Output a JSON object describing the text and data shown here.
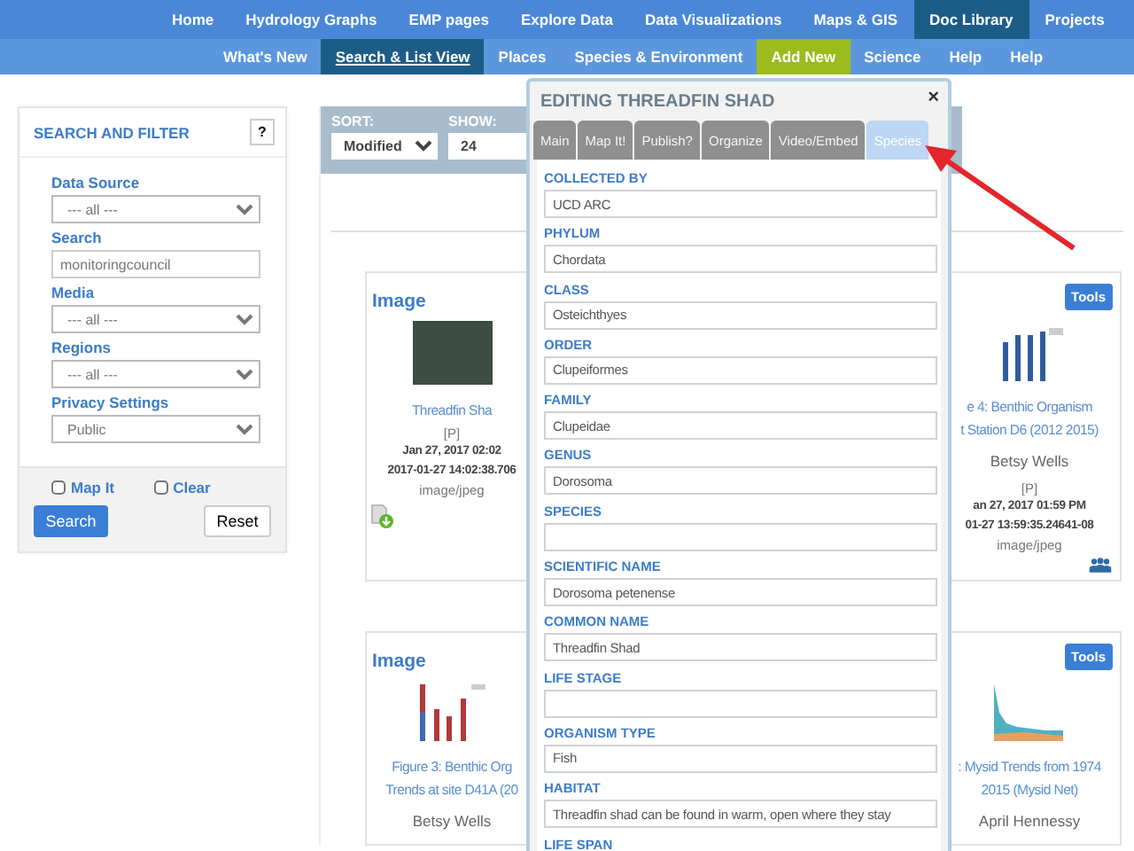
{
  "top_nav": [
    {
      "label": "Home",
      "selected": false
    },
    {
      "label": "Hydrology Graphs",
      "selected": false
    },
    {
      "label": "EMP pages",
      "selected": false
    },
    {
      "label": "Explore Data",
      "selected": false
    },
    {
      "label": "Data Visualizations",
      "selected": false
    },
    {
      "label": "Maps & GIS",
      "selected": false
    },
    {
      "label": "Doc Library",
      "selected": true
    },
    {
      "label": "Projects",
      "selected": false
    }
  ],
  "sub_nav": [
    {
      "label": "What's New",
      "selected": false,
      "kind": "link"
    },
    {
      "label": "Search & List View",
      "selected": true,
      "kind": "link"
    },
    {
      "label": "Places",
      "selected": false,
      "kind": "link"
    },
    {
      "label": "Species & Environment",
      "selected": false,
      "kind": "link"
    },
    {
      "label": "Add New",
      "selected": false,
      "kind": "accent"
    },
    {
      "label": "Science",
      "selected": false,
      "kind": "link"
    },
    {
      "label": "Help",
      "selected": false,
      "kind": "link"
    },
    {
      "label": "Help",
      "selected": false,
      "kind": "link"
    }
  ],
  "filter_panel": {
    "title": "SEARCH AND FILTER",
    "help_button": "?",
    "fields": [
      {
        "label": "Data Source",
        "kind": "select",
        "value": "--- all ---"
      },
      {
        "label": "Search",
        "kind": "text",
        "value": "monitoringcouncil"
      },
      {
        "label": "Media",
        "kind": "select",
        "value": "--- all ---"
      },
      {
        "label": "Regions",
        "kind": "select",
        "value": "--- all ---"
      },
      {
        "label": "Privacy Settings",
        "kind": "select",
        "value": "Public"
      }
    ],
    "checkboxes": [
      {
        "label": "Map It",
        "checked": false
      },
      {
        "label": "Clear",
        "checked": false
      }
    ],
    "search_button": "Search",
    "reset_button": "Reset"
  },
  "toolbar": {
    "sort": {
      "label": "SORT:",
      "value": "Modified"
    },
    "show": {
      "label": "SHOW:",
      "value": "24"
    }
  },
  "cards": [
    {
      "title": "Image",
      "tools_button": "Tools",
      "items": [
        {
          "kind": "photo",
          "title_lines": [
            "Threadfin Sha"
          ],
          "badge": "[P]",
          "date": "Jan 27, 2017 02:02",
          "timestamp": "2017-01-27 14:02:38.706",
          "mime": "image/jpeg"
        },
        {
          "kind": "bar_chart",
          "title_lines": [
            "e 4: Benthic Organism",
            "t Station D6 (2012 2015)"
          ],
          "author": "Betsy Wells",
          "badge": "[P]",
          "date": "an 27, 2017 01:59 PM",
          "timestamp": "01-27 13:59:35.24641-08",
          "mime": "image/jpeg"
        }
      ]
    },
    {
      "title": "Image",
      "tools_button": "Tools",
      "items": [
        {
          "kind": "stacked_bar",
          "title_lines": [
            "Figure 3: Benthic Org",
            "Trends at site D41A (20"
          ],
          "author": "Betsy Wells"
        },
        {
          "kind": "histogram",
          "title_lines": [
            ": Mysid Trends from 1974",
            "2015 (Mysid Net)"
          ],
          "author": "April Hennessy"
        }
      ]
    }
  ],
  "editor": {
    "title": "EDITING THREADFIN SHAD",
    "close": "×",
    "tabs": [
      {
        "label": "Main",
        "selected": false
      },
      {
        "label": "Map It!",
        "selected": false
      },
      {
        "label": "Publish?",
        "selected": false
      },
      {
        "label": "Organize",
        "selected": false
      },
      {
        "label": "Video/Embed",
        "selected": false
      },
      {
        "label": "Species",
        "selected": true
      }
    ],
    "fields": [
      {
        "label": "COLLECTED BY",
        "value": "UCD ARC"
      },
      {
        "label": "PHYLUM",
        "value": "Chordata"
      },
      {
        "label": "CLASS",
        "value": "Osteichthyes"
      },
      {
        "label": "ORDER",
        "value": "Clupeiformes"
      },
      {
        "label": "FAMILY",
        "value": "Clupeidae"
      },
      {
        "label": "GENUS",
        "value": "Dorosoma"
      },
      {
        "label": "SPECIES"
      },
      {
        "label": "SCIENTIFIC NAME",
        "value": "Dorosoma petenense"
      },
      {
        "label": "COMMON NAME",
        "value": "Threadfin Shad"
      },
      {
        "label": "LIFE STAGE"
      },
      {
        "label": "ORGANISM TYPE",
        "value": "Fish"
      },
      {
        "label": "HABITAT",
        "value": "Threadfin shad can be found in warm, open where they stay"
      },
      {
        "label": "LIFE SPAN"
      }
    ]
  }
}
